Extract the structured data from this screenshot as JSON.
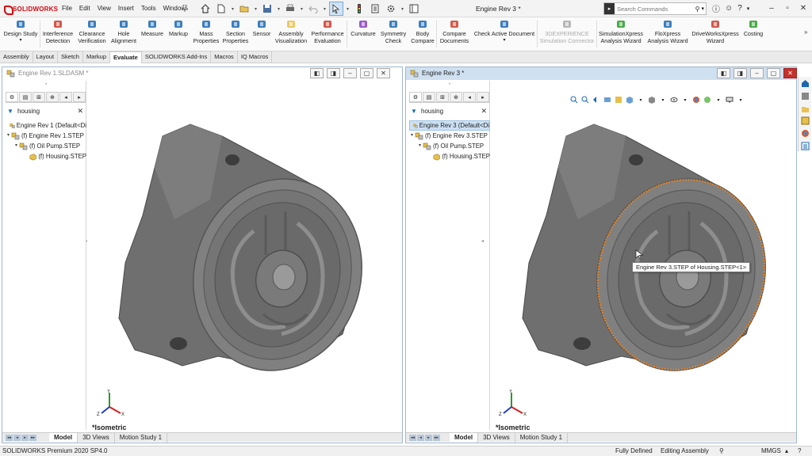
{
  "app": {
    "logo_text": "SOLIDWORKS",
    "document_title": "Engine Rev 3 *"
  },
  "menu": [
    "File",
    "Edit",
    "View",
    "Insert",
    "Tools",
    "Window"
  ],
  "search": {
    "placeholder": "Search Commands"
  },
  "ribbon": [
    {
      "line1": "Design Study",
      "line2": "",
      "icon": "design-study-icon"
    },
    {
      "line1": "Interference",
      "line2": "Detection",
      "icon": "interference-icon"
    },
    {
      "line1": "Clearance",
      "line2": "Verification",
      "icon": "clearance-icon"
    },
    {
      "line1": "Hole",
      "line2": "Alignment",
      "icon": "hole-icon"
    },
    {
      "line1": "Measure",
      "line2": "",
      "icon": "measure-icon"
    },
    {
      "line1": "Markup",
      "line2": "",
      "icon": "markup-icon"
    },
    {
      "line1": "Mass",
      "line2": "Properties",
      "icon": "mass-icon"
    },
    {
      "line1": "Section",
      "line2": "Properties",
      "icon": "section-icon"
    },
    {
      "line1": "Sensor",
      "line2": "",
      "icon": "sensor-icon"
    },
    {
      "line1": "Assembly",
      "line2": "Visualization",
      "icon": "assembly-vis-icon"
    },
    {
      "line1": "Performance",
      "line2": "Evaluation",
      "icon": "performance-icon"
    },
    {
      "line1": "Curvature",
      "line2": "",
      "icon": "curvature-icon"
    },
    {
      "line1": "Symmetry",
      "line2": "Check",
      "icon": "symmetry-icon"
    },
    {
      "line1": "Body",
      "line2": "Compare",
      "icon": "body-compare-icon"
    },
    {
      "line1": "Compare",
      "line2": "Documents",
      "icon": "compare-docs-icon"
    },
    {
      "line1": "Check Active Document",
      "line2": "",
      "icon": "check-doc-icon"
    },
    {
      "line1": "3DEXPERIENCE",
      "line2": "Simulation Connector",
      "icon": "3dx-icon"
    },
    {
      "line1": "SimulationXpress",
      "line2": "Analysis Wizard",
      "icon": "simxpress-icon"
    },
    {
      "line1": "FloXpress",
      "line2": "Analysis Wizard",
      "icon": "floxpress-icon"
    },
    {
      "line1": "DriveWorksXpress",
      "line2": "Wizard",
      "icon": "driveworks-icon"
    },
    {
      "line1": "Costing",
      "line2": "",
      "icon": "costing-icon"
    }
  ],
  "tabs": [
    "Assembly",
    "Layout",
    "Sketch",
    "Markup",
    "Evaluate",
    "SOLIDWORKS Add-Ins",
    "Macros",
    "IQ Macros"
  ],
  "active_tab": "Evaluate",
  "windows": [
    {
      "title": "Engine Rev 1.SLDASM *",
      "filter": "housing",
      "tree": [
        "Engine Rev 1  (Default<Di",
        "(f) Engine Rev 1.STEP",
        "(f) Oil Pump.STEP",
        "(f) Housing.STEP"
      ],
      "view_label": "*Isometric",
      "bottom_tabs": [
        "Model",
        "3D Views",
        "Motion Study 1"
      ]
    },
    {
      "title": "Engine Rev 3 *",
      "filter": "housing",
      "tree": [
        "Engine Rev 3  (Default<Di",
        "(f) Engine Rev 3.STEP",
        "(f) Oil Pump.STEP",
        "(f) Housing.STEP"
      ],
      "view_label": "*Isometric",
      "bottom_tabs": [
        "Model",
        "3D Views",
        "Motion Study 1"
      ]
    }
  ],
  "tooltip": "Engine Rev 3.STEP of Housing.STEP<1>",
  "status": {
    "version": "SOLIDWORKS Premium 2020 SP4.0",
    "defined": "Fully Defined",
    "mode": "Editing Assembly",
    "units": "MMGS"
  },
  "colors": {
    "selection": "#e8821e",
    "part": "#6b6b6b",
    "accent": "#1a68b1"
  }
}
